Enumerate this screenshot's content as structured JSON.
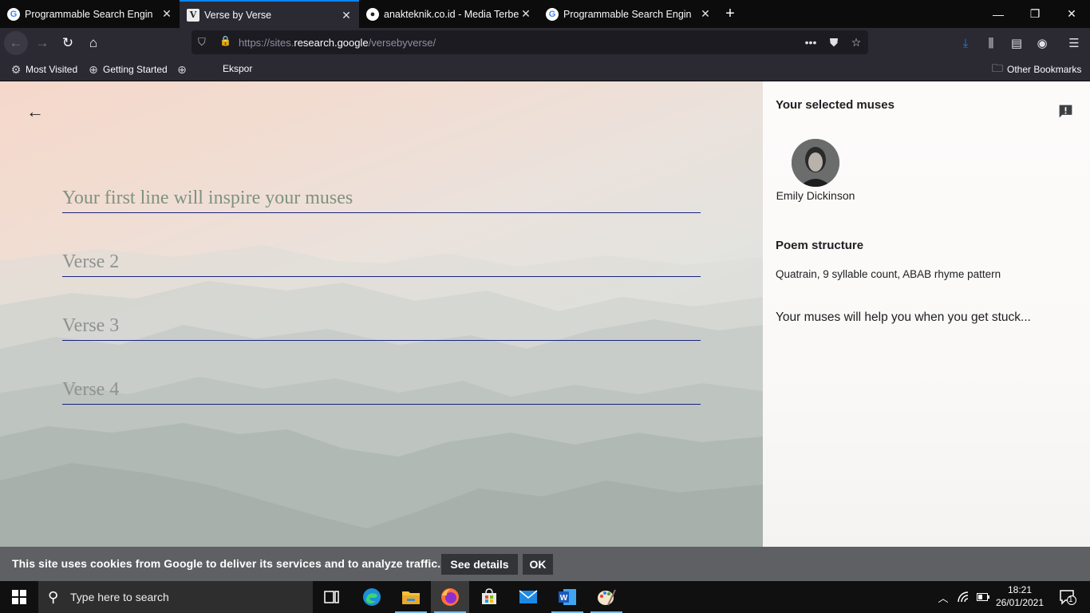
{
  "browser": {
    "tabs": [
      {
        "title": "Programmable Search Engine",
        "favicon": "google-g-icon",
        "active": false
      },
      {
        "title": "Verse by Verse",
        "favicon": "verse-v-icon",
        "active": true
      },
      {
        "title": "anakteknik.co.id - Media Terbe",
        "favicon": "anakteknik-icon",
        "active": false
      },
      {
        "title": "Programmable Search Engine",
        "favicon": "google-g-icon",
        "active": false
      }
    ],
    "url_prefix": "https://sites.",
    "url_host": "research.google",
    "url_path": "/versebyverse/",
    "bookmarks": {
      "most_visited": "Most Visited",
      "getting_started": "Getting Started",
      "ekspor": "Ekspor",
      "other": "Other Bookmarks"
    }
  },
  "page": {
    "verses": [
      {
        "placeholder": "Your first line will inspire your muses"
      },
      {
        "placeholder": "Verse 2"
      },
      {
        "placeholder": "Verse 3"
      },
      {
        "placeholder": "Verse 4"
      }
    ],
    "sidebar": {
      "muses_heading": "Your selected muses",
      "muse_name": "Emily Dickinson",
      "structure_heading": "Poem structure",
      "structure_text": "Quatrain, 9 syllable count, ABAB rhyme pattern",
      "stuck_text": "Your muses will help you when you get stuck..."
    }
  },
  "cookie": {
    "text": "This site uses cookies from Google to deliver its services and to analyze traffic.",
    "details_label": "See details",
    "ok_label": "OK"
  },
  "taskbar": {
    "search_placeholder": "Type here to search",
    "time": "18:21",
    "date": "26/01/2021",
    "notification_count": "1"
  },
  "colors": {
    "accent": "#0a84ff",
    "verse_underline": "#1a237e",
    "cookie_bar": "#5f6064"
  }
}
